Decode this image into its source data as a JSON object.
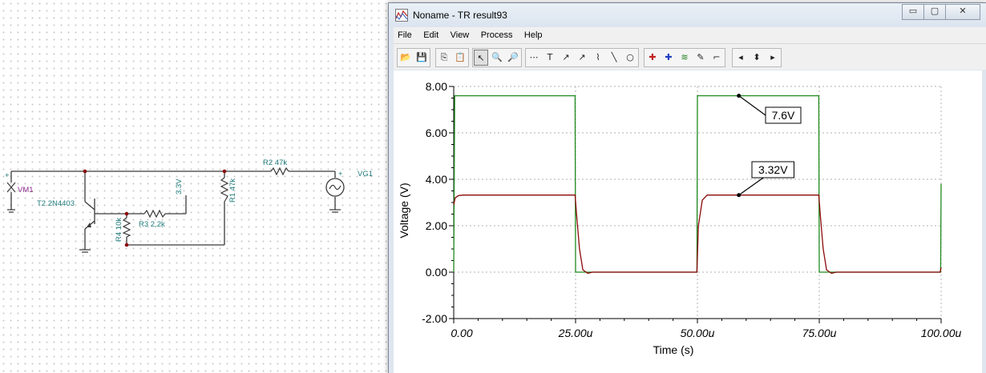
{
  "schematic": {
    "components": {
      "vm1": "VM1",
      "t2": "T2 2N4403",
      "r4": "R4 10k",
      "r3": "R3 2.2k",
      "v33": "3.3V",
      "r1": "R1 47k",
      "r2": "R2 47k",
      "vg1": "VG1",
      "plus": "+"
    }
  },
  "window": {
    "title": "Noname - TR result93",
    "controls": {
      "minimize": "▭",
      "maximize": "▢",
      "close": "✕"
    },
    "menu": [
      "File",
      "Edit",
      "View",
      "Process",
      "Help"
    ],
    "toolbar_icons": [
      "open-folder-icon",
      "save-icon",
      "copy-icon",
      "paste-icon",
      "pointer-icon",
      "zoom-in-icon",
      "zoom-out-icon",
      "grid-icon",
      "text-icon",
      "cursor-a-icon",
      "cursor-b-icon",
      "curve-icon",
      "line-icon",
      "circle-icon",
      "marker-a-icon",
      "marker-b-icon",
      "wave-icon",
      "pen-icon",
      "step-icon",
      "nav-left-icon",
      "nav-updown-icon",
      "nav-right-icon"
    ],
    "toolbar_glyphs": [
      "📂",
      "💾",
      "⎘",
      "📋",
      "↖",
      "🔍",
      "🔎",
      "⋯",
      "T",
      "↗",
      "↗",
      "⌇",
      "╲",
      "○",
      "✚",
      "✚",
      "≋",
      "✎",
      "⌐",
      "◂",
      "⬍",
      "▸"
    ]
  },
  "chart_data": {
    "type": "line",
    "xlabel": "Time (s)",
    "ylabel": "Voltage (V)",
    "xlim": [
      0,
      100
    ],
    "ylim": [
      -2,
      8
    ],
    "x_ticks": [
      "0.00",
      "25.00u",
      "50.00u",
      "75.00u",
      "100.00u"
    ],
    "y_ticks": [
      "8.00",
      "6.00",
      "4.00",
      "2.00",
      "0.00",
      "-2.00"
    ],
    "grid": true,
    "series": [
      {
        "color": "#1f8a1f",
        "x": [
          0,
          0.2,
          24.9,
          25.0,
          49.9,
          50.0,
          74.9,
          75.0,
          99.9,
          100
        ],
        "y": [
          0,
          7.6,
          7.6,
          0,
          0,
          7.6,
          7.6,
          0,
          0,
          3.8
        ]
      },
      {
        "color": "#8b0a0a",
        "x": [
          0,
          0.3,
          1.0,
          2.0,
          24.9,
          25.2,
          25.8,
          26.5,
          27.5,
          28.5,
          49.9,
          50.2,
          51.0,
          52.0,
          74.9,
          75.2,
          75.8,
          76.5,
          77.5,
          78.5,
          99.8,
          100
        ],
        "y": [
          2.9,
          3.2,
          3.3,
          3.32,
          3.32,
          2.5,
          1.0,
          0.1,
          -0.05,
          0,
          0,
          2.0,
          3.1,
          3.32,
          3.32,
          2.5,
          1.0,
          0.1,
          -0.05,
          0,
          0,
          0.2
        ]
      }
    ],
    "annotations": [
      {
        "text": "7.6V",
        "x": 58.5,
        "y": 7.6
      },
      {
        "text": "3.32V",
        "x": 58.5,
        "y": 3.32
      }
    ]
  }
}
